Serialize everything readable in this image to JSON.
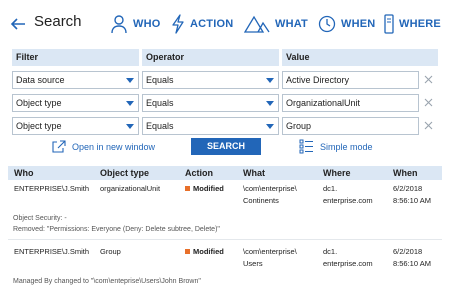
{
  "header": {
    "title": "Search",
    "nav": [
      {
        "id": "who",
        "label": "WHO",
        "icon": "person-icon"
      },
      {
        "id": "action",
        "label": "ACTION",
        "icon": "lightning-icon"
      },
      {
        "id": "what",
        "label": "WHAT",
        "icon": "triangle-shapes-icon"
      },
      {
        "id": "when",
        "label": "WHEN",
        "icon": "clock-icon"
      },
      {
        "id": "where",
        "label": "WHERE",
        "icon": "server-icon"
      }
    ]
  },
  "filters": {
    "headers": {
      "filter": "Filter",
      "operator": "Operator",
      "value": "Value"
    },
    "rows": [
      {
        "filter": "Data source",
        "operator": "Equals",
        "value": "Active Directory"
      },
      {
        "filter": "Object type",
        "operator": "Equals",
        "value": "OrganizationalUnit"
      },
      {
        "filter": "Object type",
        "operator": "Equals",
        "value": "Group"
      }
    ]
  },
  "actions": {
    "open_new_window": "Open in new window",
    "search": "SEARCH",
    "simple_mode": "Simple mode"
  },
  "results": {
    "headers": {
      "who": "Who",
      "object_type": "Object type",
      "action": "Action",
      "what": "What",
      "where": "Where",
      "when": "When"
    },
    "rows": [
      {
        "who": "ENTERPRISE\\J.Smith",
        "object_type": "organizationalUnit",
        "action": "Modified",
        "what_line1": "\\com\\enterprise\\",
        "what_line2": "Continents",
        "where_line1": "dc1.",
        "where_line2": "enterprise.com",
        "when_date": "6/2/2018",
        "when_time": "8:56:10 AM",
        "detail_line1": "Object Security: -",
        "detail_line2": "Removed: \"Permissions: Everyone (Deny: Delete subtree, Delete)\""
      },
      {
        "who": "ENTERPRISE\\J.Smith",
        "object_type": "Group",
        "action": "Modified",
        "what_line1": "\\com\\enterprise\\",
        "what_line2": "Users",
        "where_line1": "dc1.",
        "where_line2": "enterprise.com",
        "when_date": "6/2/2018",
        "when_time": "8:56:10 AM",
        "detail_line1": "Managed By changed to \"\\com\\enteprise\\Users\\John Brown\""
      }
    ]
  },
  "colors": {
    "accent": "#2266b8",
    "header_bg": "#dbe7f4",
    "modified_bullet": "#e8702a"
  }
}
